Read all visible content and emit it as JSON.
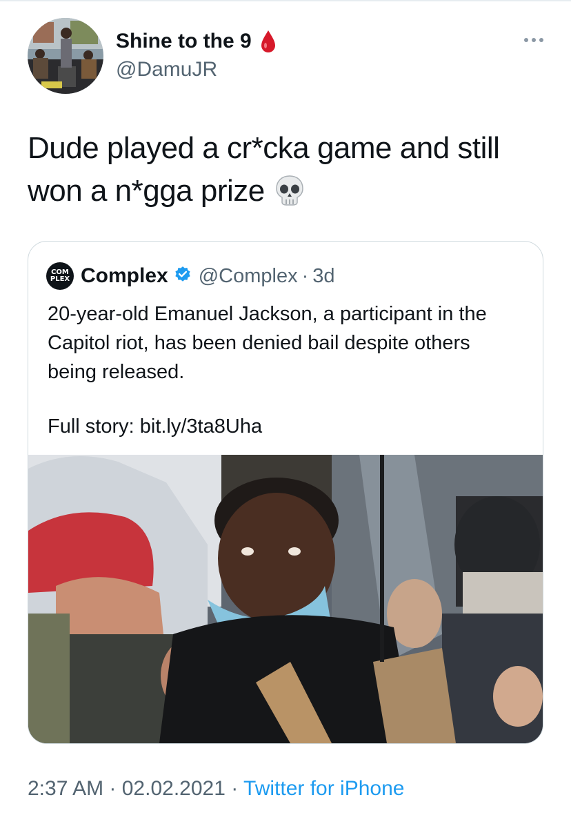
{
  "author": {
    "name": "Shine to the 9",
    "handle": "@DamuJR",
    "name_emoji_icon": "blood-drop-icon"
  },
  "tweet": {
    "text": "Dude played a cr*cka game and still won a n*gga prize",
    "emoji_icon": "skull-icon"
  },
  "quoted": {
    "logo_text_top": "COM",
    "logo_text_bottom": "PLEX",
    "name": "Complex",
    "verified_icon": "verified-badge-icon",
    "handle": "@Complex",
    "separator": "·",
    "time": "3d",
    "text": "20-year-old Emanuel Jackson, a participant in the Capitol riot, has been denied bail despite others being released.",
    "link_text": "Full story: bit.ly/3ta8Uha"
  },
  "footer": {
    "time": "2:37 AM",
    "sep1": " · ",
    "date": "02.02.2021",
    "sep2": " · ",
    "source": "Twitter for iPhone"
  },
  "colors": {
    "primary_text": "#0f1419",
    "secondary_text": "#536471",
    "link": "#1d9bf0",
    "border": "#cfd9de",
    "verified": "#1d9bf0"
  }
}
